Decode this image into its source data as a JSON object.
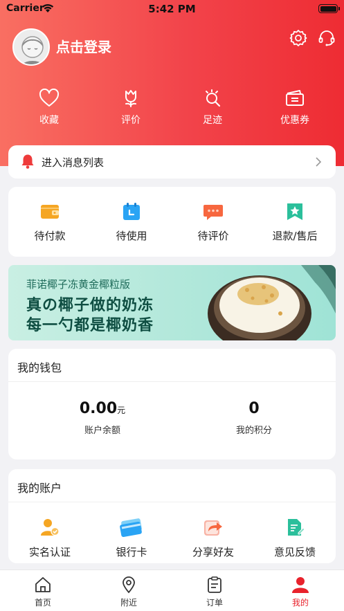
{
  "status_bar": {
    "carrier": "Carrier",
    "time": "5:42 PM"
  },
  "profile": {
    "login_label": "点击登录"
  },
  "quick_actions": [
    {
      "label": "收藏",
      "icon": "heart-icon"
    },
    {
      "label": "评价",
      "icon": "tulip-icon"
    },
    {
      "label": "足迹",
      "icon": "footprint-icon"
    },
    {
      "label": "优惠券",
      "icon": "coupon-icon"
    }
  ],
  "message_bar": {
    "label": "进入消息列表"
  },
  "order_status": [
    {
      "label": "待付款",
      "icon": "wallet-icon",
      "color": "#f5a623"
    },
    {
      "label": "待使用",
      "icon": "calendar-icon",
      "color": "#2aa4f4"
    },
    {
      "label": "待评价",
      "icon": "chat-icon",
      "color": "#f7673f"
    },
    {
      "label": "退款/售后",
      "icon": "star-badge-icon",
      "color": "#2bbf9b"
    }
  ],
  "banner": {
    "subtitle": "菲诺椰子冻黄金椰粒版",
    "line1": "真の椰子做的奶冻",
    "line2": "每一勺都是椰奶香"
  },
  "wallet": {
    "title": "我的钱包",
    "balance_value": "0.00",
    "balance_unit": "元",
    "balance_label": "账户余额",
    "points_value": "0",
    "points_label": "我的积分"
  },
  "account": {
    "title": "我的账户",
    "items": [
      {
        "label": "实名认证",
        "icon": "verified-user-icon"
      },
      {
        "label": "银行卡",
        "icon": "bank-card-icon"
      },
      {
        "label": "分享好友",
        "icon": "share-icon"
      },
      {
        "label": "意见反馈",
        "icon": "feedback-icon"
      }
    ]
  },
  "tabs": [
    {
      "label": "首页",
      "icon": "home-icon"
    },
    {
      "label": "附近",
      "icon": "location-icon"
    },
    {
      "label": "订单",
      "icon": "clipboard-icon"
    },
    {
      "label": "我的",
      "icon": "user-icon",
      "active": true
    }
  ],
  "colors": {
    "brand_red": "#ee2c33",
    "active_tab": "#e8222c",
    "banner_bg": "#b3e8db"
  }
}
